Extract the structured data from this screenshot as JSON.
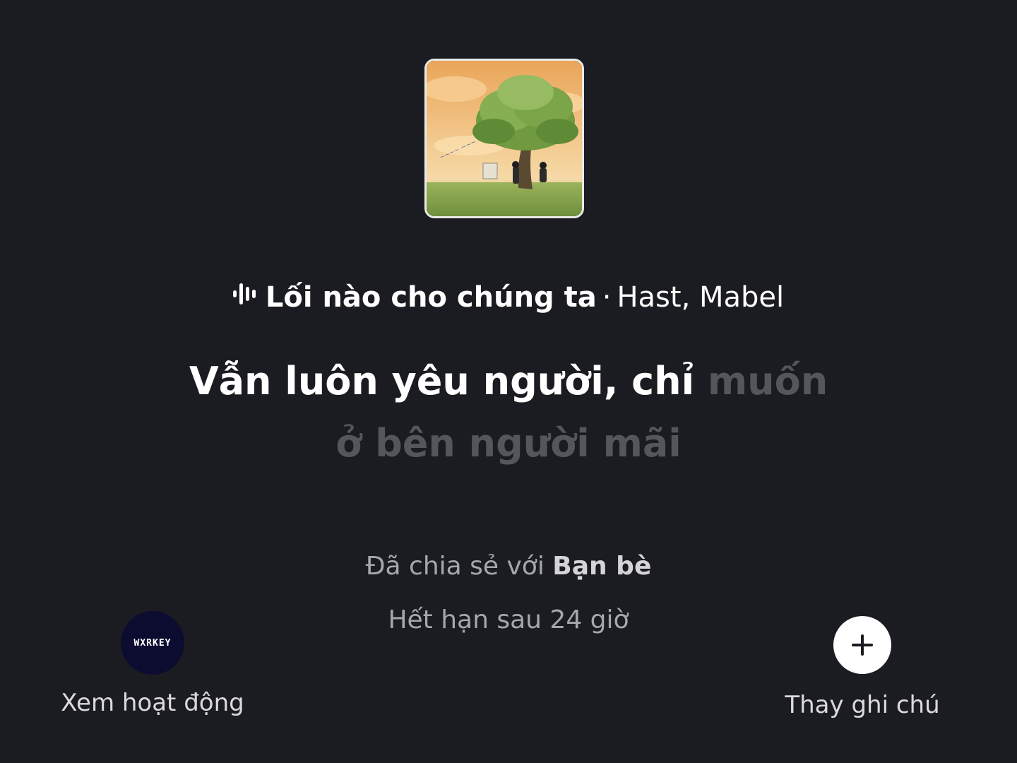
{
  "track": {
    "song": "Lối nào cho chúng ta",
    "separator": "·",
    "artist": "Hast, Mabel",
    "icon": "audio-bars-icon"
  },
  "lyrics": {
    "line1_sung": "Vẫn luôn yêu người, chỉ",
    "line1_unsung": "muốn",
    "line2_unsung": "ở bên người mãi"
  },
  "sharing": {
    "prefix": "Đã chia sẻ với",
    "audience": "Bạn bè",
    "expiry": "Hết hạn sau 24 giờ"
  },
  "activity": {
    "avatar_text": "WXRKEY",
    "label": "Xem hoạt động"
  },
  "note": {
    "icon": "plus-icon",
    "label": "Thay ghi chú"
  },
  "colors": {
    "background": "#1b1c21",
    "lyric_active": "#ffffff",
    "lyric_inactive": "#55565b",
    "secondary_text": "#a6a7ab"
  }
}
